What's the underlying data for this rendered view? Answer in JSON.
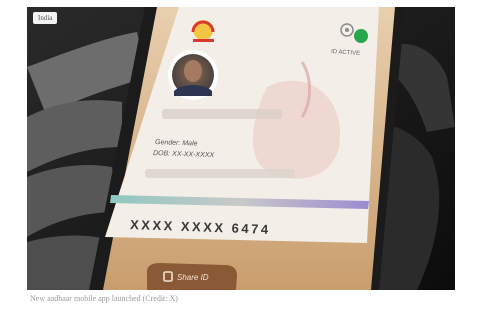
{
  "photo": {
    "tag": "India",
    "card": {
      "status": "ID ACTIVE",
      "gender_line": "Gender: Male",
      "dob_line": "DOB: XX-XX-XXXX",
      "number": "XXXX XXXX 6474"
    },
    "share_button_label": "Share ID"
  },
  "caption": "New aadhaar mobile app launched (Credit: X)",
  "colors": {
    "background": "#161616",
    "phone_screen": "#d9b48a",
    "card": "#f3eee8",
    "status_green": "#2aa64a",
    "share_button": "#8a5a36"
  }
}
